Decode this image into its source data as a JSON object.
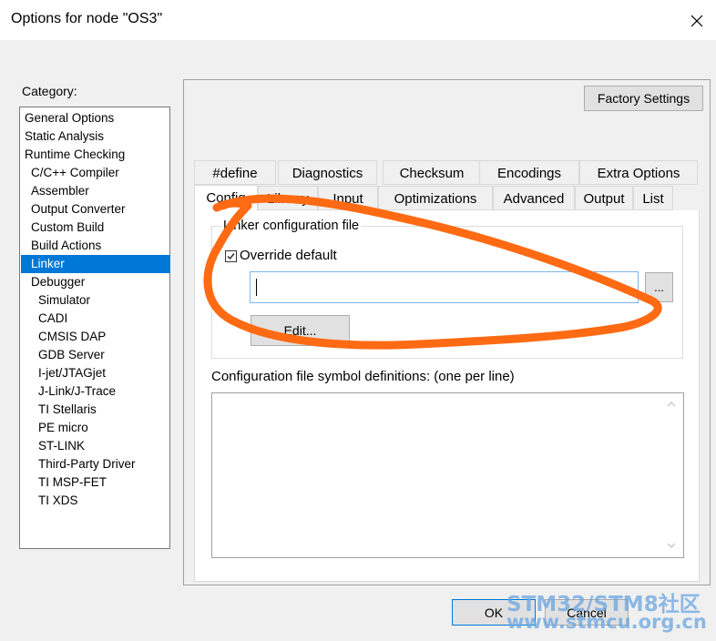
{
  "window": {
    "title": "Options for node \"OS3\""
  },
  "category": {
    "label": "Category:",
    "selected": "Linker",
    "items": [
      {
        "label": "General Options",
        "indent": 0
      },
      {
        "label": "Static Analysis",
        "indent": 0
      },
      {
        "label": "Runtime Checking",
        "indent": 0
      },
      {
        "label": "C/C++ Compiler",
        "indent": 1
      },
      {
        "label": "Assembler",
        "indent": 1
      },
      {
        "label": "Output Converter",
        "indent": 1
      },
      {
        "label": "Custom Build",
        "indent": 1
      },
      {
        "label": "Build Actions",
        "indent": 1
      },
      {
        "label": "Linker",
        "indent": 1
      },
      {
        "label": "Debugger",
        "indent": 1
      },
      {
        "label": "Simulator",
        "indent": 2
      },
      {
        "label": "CADI",
        "indent": 2
      },
      {
        "label": "CMSIS DAP",
        "indent": 2
      },
      {
        "label": "GDB Server",
        "indent": 2
      },
      {
        "label": "I-jet/JTAGjet",
        "indent": 2
      },
      {
        "label": "J-Link/J-Trace",
        "indent": 2
      },
      {
        "label": "TI Stellaris",
        "indent": 2
      },
      {
        "label": "PE micro",
        "indent": 2
      },
      {
        "label": "ST-LINK",
        "indent": 2
      },
      {
        "label": "Third-Party Driver",
        "indent": 2
      },
      {
        "label": "TI MSP-FET",
        "indent": 2
      },
      {
        "label": "TI XDS",
        "indent": 2
      }
    ]
  },
  "panel": {
    "factory_settings": "Factory Settings",
    "tabs_top": [
      "#define",
      "Diagnostics",
      "Checksum",
      "Encodings",
      "Extra Options"
    ],
    "tabs_bottom": [
      "Config",
      "Library",
      "Input",
      "Optimizations",
      "Advanced",
      "Output",
      "List"
    ],
    "active_tab": "Config",
    "linker_group_title": "Linker configuration file",
    "override_default_label": "Override default",
    "override_default_checked": true,
    "config_file_value": "",
    "browse_label": "...",
    "edit_label": "Edit...",
    "symbols_label": "Configuration file symbol definitions: (one per line)",
    "symbols_value": ""
  },
  "footer": {
    "ok_label": "OK",
    "cancel_label": "Cancel"
  },
  "watermark": {
    "line1": "STM32/STM8社区",
    "line2": "www.stmcu.org.cn"
  },
  "colors": {
    "selection": "#0078d7",
    "annotation": "#ff6a13",
    "watermark": "#6aa6e2"
  },
  "icons": {
    "close": "close-icon",
    "check": "checkmark-icon",
    "scroll_up": "chevron-up-icon",
    "scroll_down": "chevron-down-icon"
  }
}
